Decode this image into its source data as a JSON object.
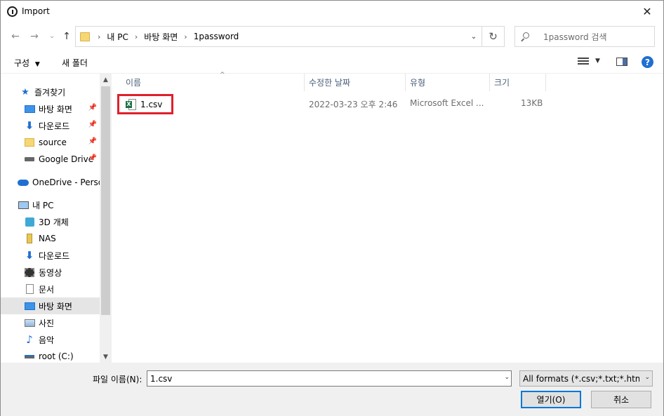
{
  "window": {
    "title": "Import"
  },
  "navbar": {
    "breadcrumbs": [
      "내 PC",
      "바탕 화면",
      "1password"
    ],
    "search_placeholder": "1password 검색"
  },
  "toolbar": {
    "organize_label": "구성",
    "new_folder_label": "새 폴더"
  },
  "sidebar": {
    "items": [
      {
        "label": "즐겨찾기",
        "icon": "star-icon"
      },
      {
        "label": "바탕 화면",
        "icon": "desktop-icon",
        "pinned": true
      },
      {
        "label": "다운로드",
        "icon": "download-icon",
        "pinned": true
      },
      {
        "label": "source",
        "icon": "folder-icon",
        "pinned": true
      },
      {
        "label": "Google Drive",
        "icon": "drive-icon",
        "pinned": true
      },
      {
        "label": "OneDrive - Personal",
        "icon": "cloud-icon"
      },
      {
        "label": "내 PC",
        "icon": "pc-icon"
      },
      {
        "label": "3D 개체",
        "icon": "3d-objects-icon"
      },
      {
        "label": "NAS",
        "icon": "nas-icon"
      },
      {
        "label": "다운로드",
        "icon": "download-icon"
      },
      {
        "label": "동영상",
        "icon": "video-icon"
      },
      {
        "label": "문서",
        "icon": "document-icon"
      },
      {
        "label": "바탕 화면",
        "icon": "desktop-icon",
        "selected": true
      },
      {
        "label": "사진",
        "icon": "picture-icon"
      },
      {
        "label": "음악",
        "icon": "music-icon"
      },
      {
        "label": "root (C:)",
        "icon": "drive-c-icon"
      }
    ]
  },
  "files": {
    "columns": [
      "이름",
      "수정한 날짜",
      "유형",
      "크기"
    ],
    "rows": [
      {
        "name": "1.csv",
        "modified": "2022-03-23 오후 2:46",
        "type": "Microsoft Excel ...",
        "size": "13KB"
      }
    ]
  },
  "bottom": {
    "filename_label": "파일 이름(N):",
    "filename_value": "1.csv",
    "filter_value": "All formats (*.csv;*.txt;*.htm;*.h",
    "open_label": "열기(O)",
    "cancel_label": "취소"
  },
  "colors": {
    "accent": "#0078d7",
    "highlight_box": "#e0202a",
    "header_text": "#4c607a"
  }
}
